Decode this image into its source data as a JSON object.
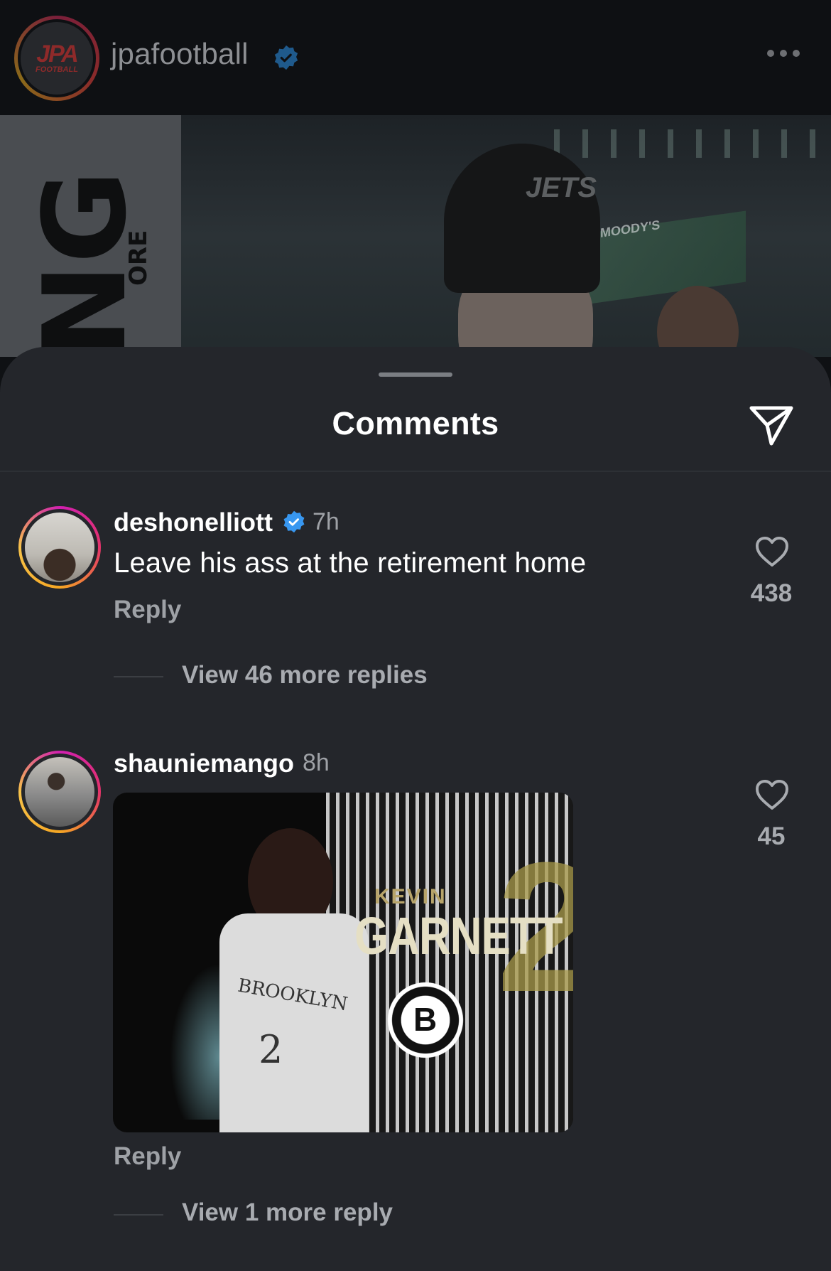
{
  "post": {
    "username": "jpafootball",
    "avatar_text_main": "JPA",
    "avatar_text_sub": "FOOTBALL",
    "media_text_large": "NG",
    "media_text_small": "ORE",
    "media_hat_text": "JETS",
    "media_board_text": "MOODY'S"
  },
  "sheet": {
    "title": "Comments"
  },
  "comments": [
    {
      "username": "deshonelliott",
      "verified": true,
      "time": "7h",
      "text": "Leave his ass at the retirement home",
      "reply_label": "Reply",
      "likes": "438",
      "view_replies": "View 46 more replies"
    },
    {
      "username": "shauniemango",
      "verified": false,
      "time": "8h",
      "gif": {
        "kevin": "KEVIN",
        "garnett": "GARNETT",
        "number": "2",
        "jersey_text": "BROOKLYN",
        "jersey_number": "2",
        "logo_letter": "B"
      },
      "reply_label": "Reply",
      "likes": "45",
      "view_replies": "View 1 more reply"
    }
  ],
  "colors": {
    "verified_blue": "#3897f0",
    "sheet_bg": "#24262b",
    "secondary_text": "#9ea1a6"
  }
}
